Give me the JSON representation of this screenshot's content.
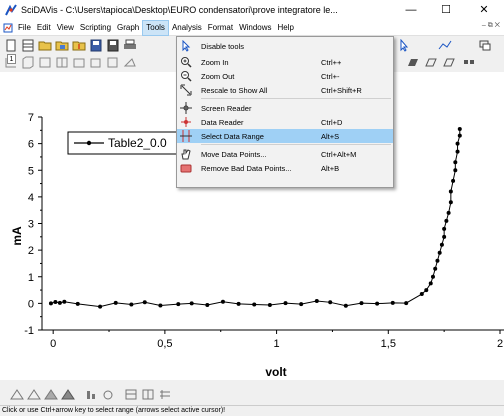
{
  "window": {
    "title": "SciDAVis - C:\\Users\\tapioca\\Desktop\\EURO condensatori\\prove integratore le...",
    "minimize": "—",
    "maximize": "☐",
    "close": "✕"
  },
  "menubar": {
    "items": [
      "File",
      "Edit",
      "View",
      "Scripting",
      "Graph",
      "Tools",
      "Analysis",
      "Format",
      "Windows",
      "Help"
    ],
    "right_controls": "– ⧉ ✕"
  },
  "tools_menu": {
    "items": [
      {
        "label": "Disable tools",
        "shortcut": "",
        "icon": "pointer-icon"
      },
      {
        "label": "Zoom In",
        "shortcut": "Ctrl++",
        "icon": "zoom-in-icon"
      },
      {
        "label": "Zoom Out",
        "shortcut": "Ctrl+-",
        "icon": "zoom-out-icon"
      },
      {
        "label": "Rescale to Show All",
        "shortcut": "Ctrl+Shift+R",
        "icon": "rescale-icon"
      },
      {
        "label": "Screen Reader",
        "shortcut": "",
        "icon": "crosshair-icon"
      },
      {
        "label": "Data Reader",
        "shortcut": "Ctrl+D",
        "icon": "data-reader-icon"
      },
      {
        "label": "Select Data Range",
        "shortcut": "Alt+S",
        "icon": "data-range-icon"
      },
      {
        "label": "Move Data Points...",
        "shortcut": "Ctrl+Alt+M",
        "icon": "hand-icon"
      },
      {
        "label": "Remove Bad Data Points...",
        "shortcut": "Alt+B",
        "icon": "eraser-icon"
      }
    ]
  },
  "workspace": {
    "window_number": "1"
  },
  "chart_data": {
    "type": "line",
    "title": "",
    "xlabel": "volt",
    "ylabel": "mA",
    "xlim": [
      -0.05,
      2.0
    ],
    "ylim": [
      -1,
      7
    ],
    "xticks": [
      "0",
      "0,5",
      "1",
      "1,5",
      "2"
    ],
    "xtick_values": [
      0,
      0.5,
      1,
      1.5,
      2
    ],
    "yticks": [
      "-1",
      "0",
      "1",
      "2",
      "3",
      "4",
      "5",
      "6",
      "7"
    ],
    "ytick_values": [
      -1,
      0,
      1,
      2,
      3,
      4,
      5,
      6,
      7
    ],
    "legend": "Table2_0.0",
    "legend_position": "top-left",
    "series": [
      {
        "name": "Table2_0.0",
        "x": [
          -0.01,
          0.01,
          0.03,
          0.05,
          0.11,
          0.21,
          0.28,
          0.35,
          0.41,
          0.48,
          0.56,
          0.62,
          0.69,
          0.76,
          0.83,
          0.9,
          0.97,
          1.04,
          1.11,
          1.18,
          1.24,
          1.31,
          1.38,
          1.45,
          1.52,
          1.58,
          1.65,
          1.67,
          1.69,
          1.7,
          1.71,
          1.72,
          1.73,
          1.74,
          1.75,
          1.75,
          1.76,
          1.77,
          1.78,
          1.78,
          1.79,
          1.8,
          1.8,
          1.81,
          1.81,
          1.82,
          1.82
        ],
        "y": [
          0.0,
          0.05,
          0.02,
          0.06,
          -0.02,
          -0.12,
          0.02,
          -0.04,
          0.04,
          -0.08,
          -0.03,
          0.0,
          -0.06,
          0.06,
          -0.02,
          -0.04,
          -0.06,
          0.01,
          -0.03,
          0.09,
          0.04,
          -0.09,
          0.01,
          -0.01,
          0.02,
          0.01,
          0.35,
          0.5,
          0.75,
          1.0,
          1.3,
          1.6,
          1.9,
          2.2,
          2.5,
          2.8,
          3.1,
          3.4,
          3.8,
          4.2,
          4.6,
          5.0,
          5.3,
          5.7,
          6.0,
          6.3,
          6.55
        ]
      }
    ]
  },
  "statusbar": {
    "text": "Click or use Ctrl+arrow key to select range (arrows select active cursor)!"
  },
  "colors": {
    "highlight": "#9fd0f5",
    "menu_active": "#cce4f7"
  }
}
